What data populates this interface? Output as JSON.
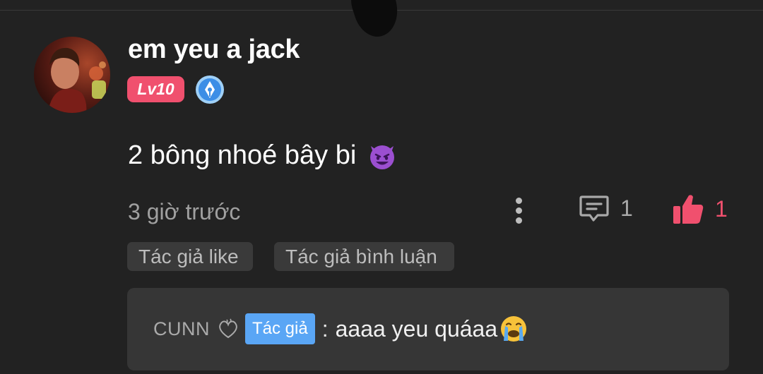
{
  "comment": {
    "username": "em yeu a jack",
    "level": "Lv10",
    "text": "2 bông nhoé bây bi",
    "emoji_icon": "smiling-devil-icon",
    "timestamp": "3 giờ trước",
    "reply_count": "1",
    "like_count": "1",
    "tags": [
      "Tác giả like",
      "Tác giả bình luận"
    ]
  },
  "reply": {
    "user": "CUNN",
    "author_badge": "Tác giả",
    "colon": ":",
    "text": "aaaa yeu quáaa",
    "emoji_icon": "crying-face-icon"
  },
  "colors": {
    "background": "#222222",
    "accent_pink": "#f0506e",
    "author_blue": "#5aa6f5",
    "tag_bg": "#3a3a3a",
    "reply_bg": "#363636"
  }
}
